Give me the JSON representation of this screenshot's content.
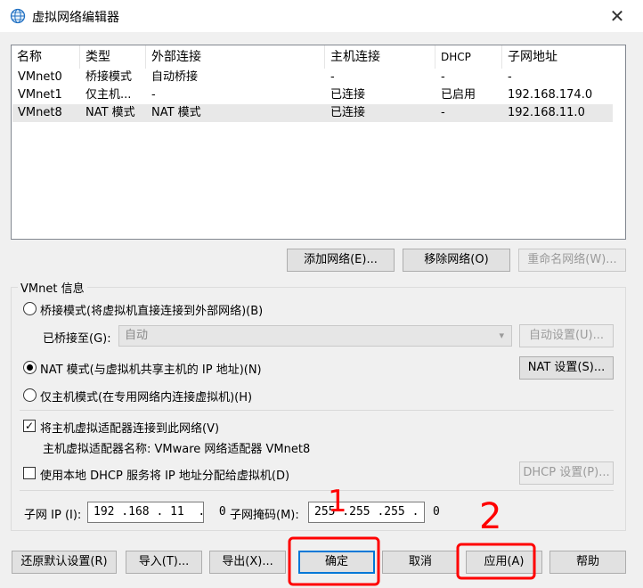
{
  "window": {
    "title": "虚拟网络编辑器",
    "close_glyph": "✕"
  },
  "table": {
    "columns": [
      "名称",
      "类型",
      "外部连接",
      "主机连接",
      "DHCP",
      "子网地址"
    ],
    "rows": [
      [
        "VMnet0",
        "桥接模式",
        "自动桥接",
        "-",
        "-",
        "-"
      ],
      [
        "VMnet1",
        "仅主机...",
        "-",
        "已连接",
        "已启用",
        "192.168.174.0"
      ],
      [
        "VMnet8",
        "NAT 模式",
        "NAT 模式",
        "已连接",
        "-",
        "192.168.11.0"
      ]
    ],
    "selected_row": "VMnet8"
  },
  "network_buttons": {
    "add": "添加网络(E)...",
    "remove": "移除网络(O)",
    "rename": "重命名网络(W)..."
  },
  "vmnet_info": {
    "group_label": "VMnet 信息",
    "bridged_label": "桥接模式(将虚拟机直接连接到外部网络)(B)",
    "bridged_to_label": "已桥接至(G):",
    "bridged_to_value": "自动",
    "auto_settings": "自动设置(U)...",
    "nat_label": "NAT 模式(与虚拟机共享主机的 IP 地址)(N)",
    "nat_settings": "NAT 设置(S)...",
    "hostonly_label": "仅主机模式(在专用网络内连接虚拟机)(H)",
    "selected_mode": "nat",
    "connect_adapter_label": "将主机虚拟适配器连接到此网络(V)",
    "connect_adapter_checked": true,
    "adapter_name_label": "主机虚拟适配器名称: VMware 网络适配器 VMnet8",
    "dhcp_label": "使用本地 DHCP 服务将 IP 地址分配给虚拟机(D)",
    "dhcp_checked": false,
    "dhcp_settings": "DHCP 设置(P)...",
    "subnet_ip_label": "子网 IP (I):",
    "subnet_ip_value": "192 .168 . 11  .  0",
    "subnet_mask_label": "子网掩码(M):",
    "subnet_mask_value": "255 .255 .255 .  0"
  },
  "bottom_buttons": {
    "restore": "还原默认设置(R)",
    "import": "导入(T)...",
    "export": "导出(X)...",
    "ok": "确定",
    "cancel": "取消",
    "apply": "应用(A)",
    "help": "帮助"
  },
  "annotations": {
    "mark1": "1",
    "mark2": "2",
    "color": "#ff0000"
  }
}
